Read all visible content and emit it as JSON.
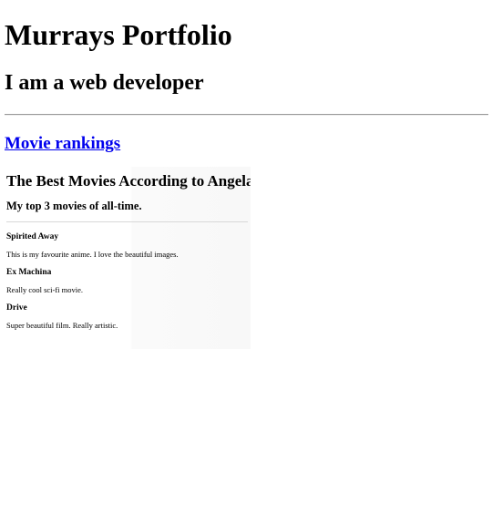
{
  "header": {
    "title": "Murrays Portfolio",
    "subtitle": "I am a web developer"
  },
  "nav": {
    "movie_link_label": "Movie rankings"
  },
  "embedded_page": {
    "title": "The Best Movies According to Angela",
    "subtitle": "My top 3 movies of all-time.",
    "movies": [
      {
        "name": "Spirited Away",
        "description": "This is my favourite anime. I love the beautiful images."
      },
      {
        "name": "Ex Machina",
        "description": "Really cool sci-fi movie."
      },
      {
        "name": "Drive",
        "description": "Super beautiful film. Really artistic."
      }
    ]
  },
  "colors": {
    "link": "#0000ee",
    "text": "#000000",
    "background": "#ffffff"
  }
}
